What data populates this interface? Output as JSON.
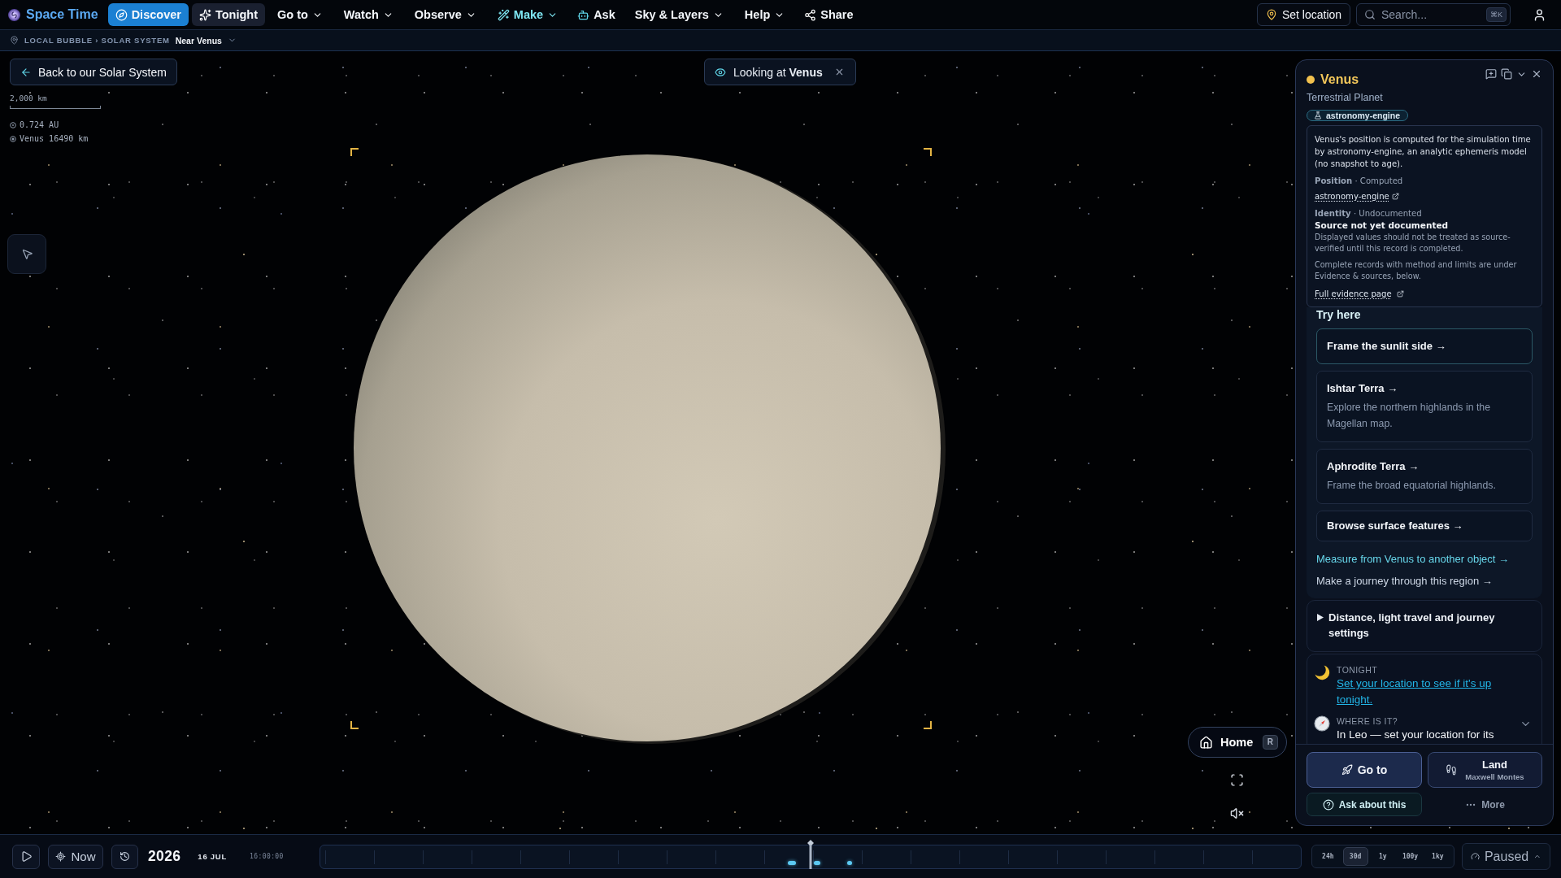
{
  "app": {
    "title": "Space Time"
  },
  "nav": [
    {
      "label": "Discover",
      "kind": "pill",
      "selected": true,
      "highlighted": false
    },
    {
      "label": "Tonight",
      "kind": "pill",
      "selected": false,
      "highlighted": false
    },
    {
      "label": "Go to",
      "kind": "menu",
      "selected": false,
      "highlighted": false
    },
    {
      "label": "Watch",
      "kind": "menu",
      "selected": false,
      "highlighted": false
    },
    {
      "label": "Observe",
      "kind": "menu",
      "selected": false,
      "highlighted": false
    },
    {
      "label": "Make",
      "kind": "menu",
      "selected": false,
      "highlighted": true
    },
    {
      "label": "Ask",
      "kind": "link",
      "selected": false,
      "highlighted": false
    },
    {
      "label": "Sky & Layers",
      "kind": "menu",
      "selected": false,
      "highlighted": false
    },
    {
      "label": "Help",
      "kind": "menu",
      "selected": false,
      "highlighted": false
    },
    {
      "label": "Share",
      "kind": "link",
      "selected": false,
      "highlighted": false
    }
  ],
  "location_button": {
    "label": "Set location"
  },
  "search": {
    "placeholder": "Search...",
    "shortcut": "⌘K"
  },
  "breadcrumb": {
    "path": "LOCAL BUBBLE › SOLAR SYSTEM",
    "current": "Near Venus"
  },
  "viewport": {
    "back_button": "Back to our Solar System",
    "focus_chip": "Looking at **Venus**",
    "scale": {
      "label": "2,000 km",
      "readouts": [
        "0.724 AU",
        "Venus 16490 km"
      ]
    },
    "home_button": {
      "label": "Home",
      "shortcut": "R"
    },
    "muted": true
  },
  "object_panel": {
    "name": "Venus",
    "type": "Terrestrial Planet",
    "source_badge": "astronomy-engine",
    "evidence": {
      "summary": "Venus's position is computed for the simulation time by astronomy-engine, an analytic ephemeris model (no snapshot to age).",
      "records": [
        {
          "heading": "**Position** · Computed",
          "link": "astronomy-engine"
        },
        {
          "heading": "**Identity** · Undocumented",
          "headline": "Source not yet documented",
          "note": "Displayed values should not be treated as source-verified until this record is completed."
        }
      ],
      "footnote": "Complete records with method and limits are under Evidence & sources, below.",
      "link": "Full evidence page"
    },
    "try_here": {
      "title": "Try here",
      "cards": [
        {
          "title": "Frame the sunlit side →",
          "highlighted": true
        },
        {
          "title": "Ishtar Terra →",
          "description": "Explore the northern highlands in the Magellan map.",
          "highlighted": false
        },
        {
          "title": "Aphrodite Terra →",
          "description": "Frame the broad equatorial highlands.",
          "highlighted": false
        },
        {
          "title": "Browse surface features →",
          "highlighted": false
        }
      ],
      "links": [
        {
          "label": "Measure from Venus to another object →",
          "kind": "accent"
        },
        {
          "label": "Make a journey through this region →",
          "kind": "plain"
        }
      ]
    },
    "settings": {
      "label": "Distance, light travel and journey settings",
      "expanded": false
    },
    "facts": [
      {
        "kind": "link",
        "label": "TONIGHT",
        "link": "Set your location to see if it's up tonight."
      },
      {
        "kind": "text",
        "label": "WHERE IS IT?",
        "text": "In Leo — set your location for its",
        "expanded": false
      }
    ],
    "actions": {
      "go_to": "Go to",
      "land": {
        "label": "Land",
        "target": "Maxwell Montes"
      },
      "ask": "Ask about this",
      "more": "More"
    }
  },
  "timebar": {
    "playing": false,
    "now": "Now",
    "year": "2026",
    "date": "16 JUL",
    "time": "16:00:00",
    "level": 0.5,
    "ranges": [
      {
        "label": "24h",
        "selected": false
      },
      {
        "label": "30d",
        "selected": true
      },
      {
        "label": "1y",
        "selected": false
      },
      {
        "label": "100y",
        "selected": false
      },
      {
        "label": "1ky",
        "selected": false
      }
    ],
    "speed": "Paused"
  }
}
